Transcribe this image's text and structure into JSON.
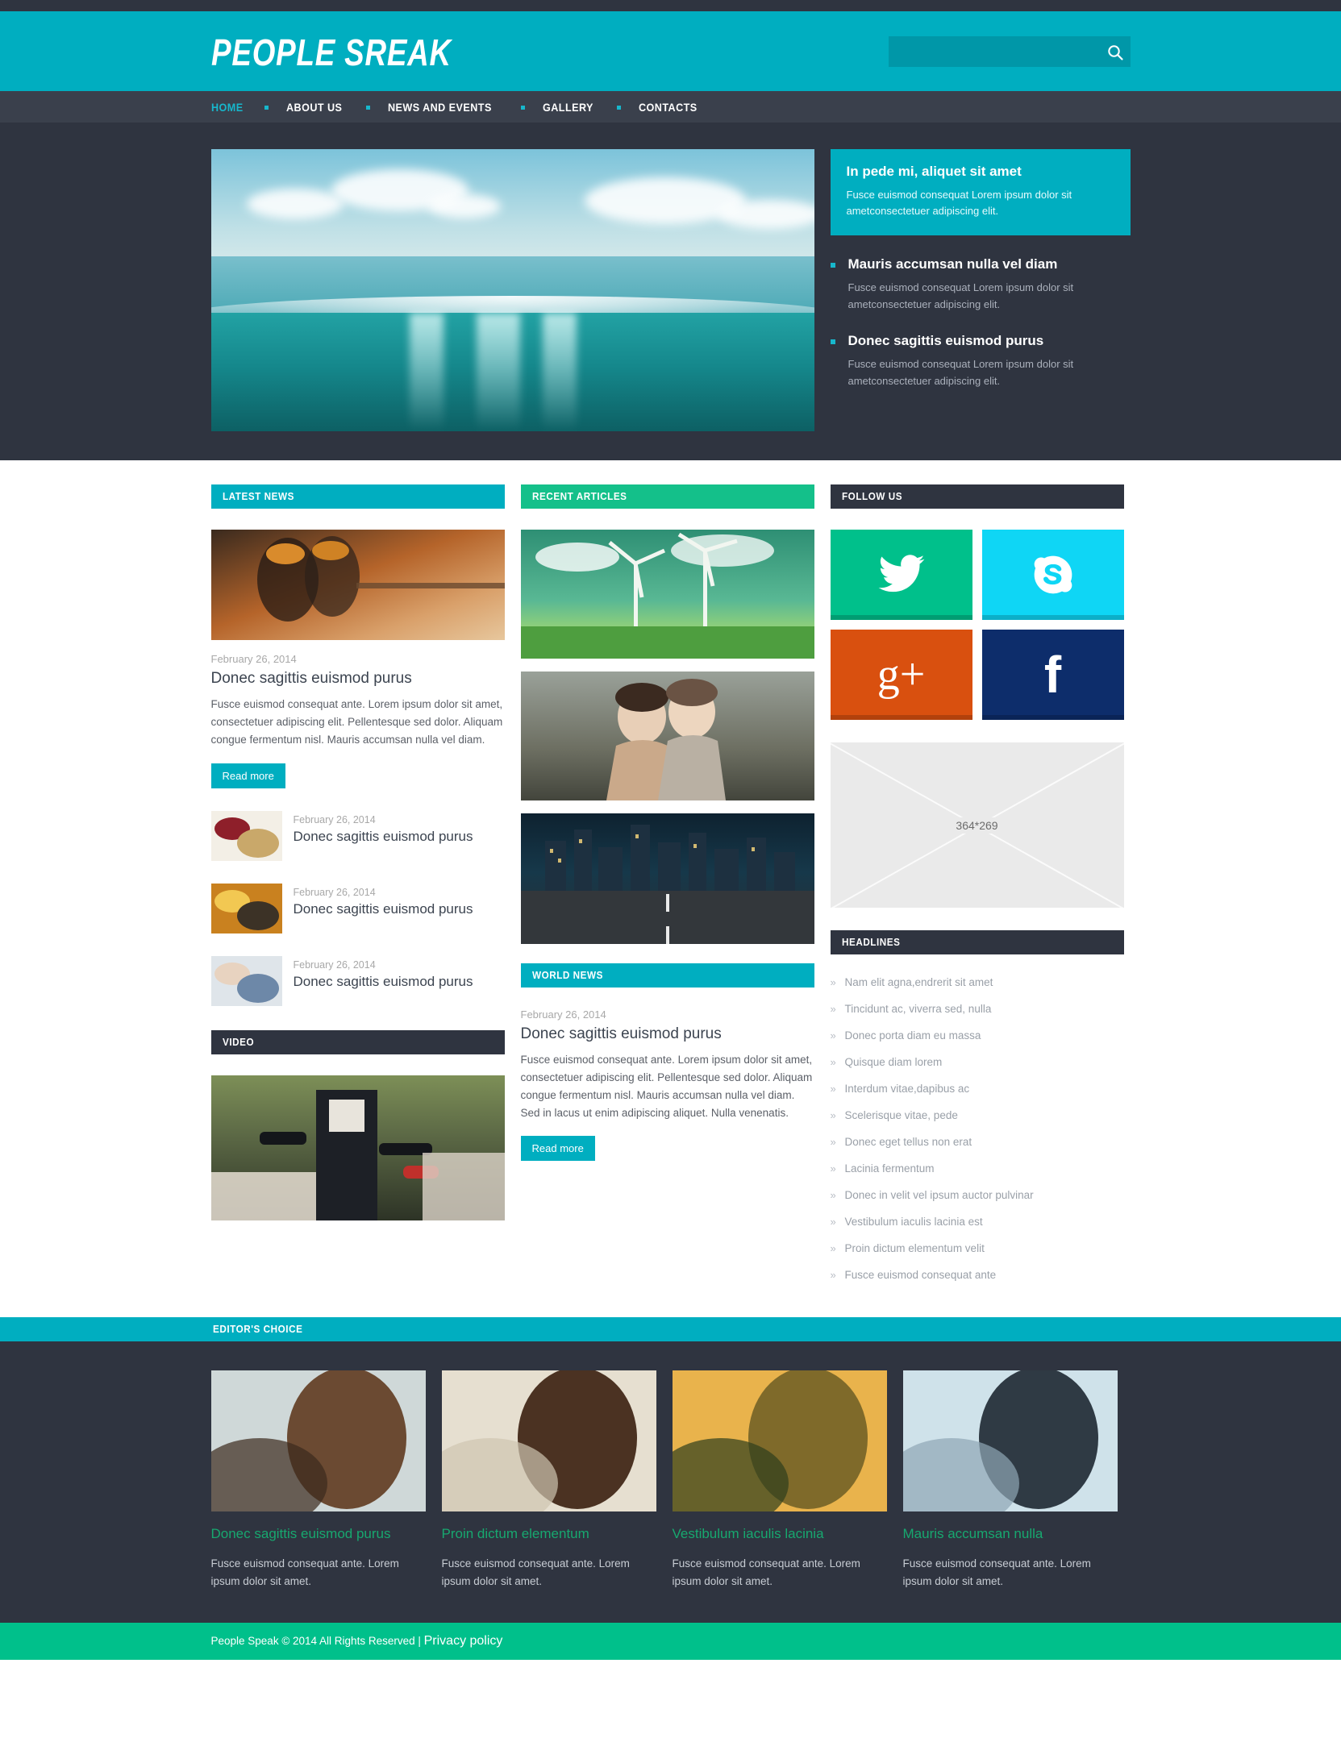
{
  "site": {
    "logo": "PEOPLE SREAK",
    "search_placeholder": "",
    "search_value": "",
    "search_icon": "search-icon"
  },
  "nav": {
    "items": [
      {
        "label": "HOME",
        "active": true
      },
      {
        "label": "ABOUT US",
        "active": false
      },
      {
        "label": "NEWS AND EVENTS",
        "active": false
      },
      {
        "label": "GALLERY",
        "active": false
      },
      {
        "label": "CONTACTS",
        "active": false
      }
    ]
  },
  "hero": {
    "image_alt": "ocean-underwater-photo",
    "featured": {
      "title": "In pede mi, aliquet sit amet",
      "text": "Fusce euismod consequat Lorem ipsum dolor sit ametconsectetuer adipiscing elit."
    },
    "bullets": [
      {
        "title": "Mauris accumsan nulla vel diam",
        "text": "Fusce euismod consequat Lorem ipsum dolor sit ametconsectetuer adipiscing elit."
      },
      {
        "title": "Donec sagittis euismod purus",
        "text": "Fusce euismod consequat Lorem ipsum dolor sit ametconsectetuer adipiscing elit."
      }
    ]
  },
  "latest_news": {
    "heading": "LATEST NEWS",
    "lead": {
      "image_alt": "firefighters-photo",
      "date": "February 26, 2014",
      "title": "Donec sagittis euismod purus",
      "body": "Fusce euismod consequat ante. Lorem ipsum dolor sit amet, consectetuer adipiscing elit. Pellentesque sed dolor. Aliquam congue fermentum nisl. Mauris accumsan nulla vel diam.",
      "read_more": "Read more"
    },
    "items": [
      {
        "image_alt": "pasta-wine-photo",
        "date": "February 26, 2014",
        "title": "Donec sagittis euismod purus"
      },
      {
        "image_alt": "firemen-portrait-photo",
        "date": "February 26, 2014",
        "title": "Donec sagittis euismod purus"
      },
      {
        "image_alt": "mother-child-photo",
        "date": "February 26, 2014",
        "title": "Donec sagittis euismod purus"
      }
    ]
  },
  "video": {
    "heading": "VIDEO",
    "image_alt": "press-microphones-photo"
  },
  "recent_articles": {
    "heading": "RECENT ARTICLES",
    "images": [
      {
        "alt": "wind-turbines-photo"
      },
      {
        "alt": "two-women-winter-photo"
      },
      {
        "alt": "city-highway-night-photo"
      }
    ]
  },
  "world_news": {
    "heading": "WORLD NEWS",
    "date": "February 26, 2014",
    "title": "Donec sagittis euismod purus",
    "body": "Fusce euismod consequat ante. Lorem ipsum dolor sit amet, consectetuer adipiscing elit. Pellentesque sed dolor. Aliquam congue fermentum nisl. Mauris accumsan nulla vel diam. Sed in lacus ut enim adipiscing aliquet. Nulla venenatis.",
    "read_more": "Read more"
  },
  "follow_us": {
    "heading": "FOLLOW US",
    "socials": [
      {
        "name": "twitter",
        "icon": "twitter-icon",
        "color": "#00c08b"
      },
      {
        "name": "skype",
        "icon": "skype-icon",
        "color": "#0fd6f5"
      },
      {
        "name": "google-plus",
        "icon": "google-plus-icon",
        "color": "#d9500f",
        "glyph": "g+"
      },
      {
        "name": "facebook",
        "icon": "facebook-icon",
        "color": "#0d2d6b",
        "glyph": "f"
      }
    ]
  },
  "placeholder": {
    "label": "364*269"
  },
  "headlines": {
    "heading": "HEADLINES",
    "bullet": "»",
    "items": [
      "Nam elit agna,endrerit sit amet",
      "Tincidunt ac, viverra sed, nulla",
      "Donec porta diam eu massa",
      "Quisque diam lorem",
      "Interdum vitae,dapibus ac",
      "Scelerisque vitae, pede",
      "Donec eget tellus non erat",
      "Lacinia fermentum",
      "Donec in velit vel ipsum auctor pulvinar",
      "Vestibulum iaculis lacinia est",
      "Proin dictum elementum velit",
      "Fusce euismod consequat ante"
    ]
  },
  "editors_choice": {
    "heading": "EDITOR'S CHOICE",
    "cards": [
      {
        "image_alt": "businessman-profile-photo",
        "title": "Donec sagittis euismod purus",
        "body": "Fusce euismod consequat ante. Lorem ipsum dolor sit amet."
      },
      {
        "image_alt": "woman-praying-photo",
        "title": "Proin dictum elementum",
        "body": "Fusce euismod consequat ante. Lorem ipsum dolor sit amet."
      },
      {
        "image_alt": "field-sunrise-arms-raised-photo",
        "title": "Vestibulum iaculis lacinia",
        "body": "Fusce euismod consequat ante. Lorem ipsum dolor sit amet."
      },
      {
        "image_alt": "hiker-snow-mountain-photo",
        "title": "Mauris accumsan nulla",
        "body": "Fusce euismod consequat ante. Lorem ipsum dolor sit amet."
      }
    ]
  },
  "footer": {
    "copyright": "People Speak © 2014 All Rights Reserved  |  ",
    "privacy": "Privacy policy"
  },
  "colors": {
    "teal": "#00aec0",
    "green": "#00c08b",
    "dark": "#2f3440",
    "nav_dark": "#3a404c",
    "accent_link": "#17a86f"
  }
}
